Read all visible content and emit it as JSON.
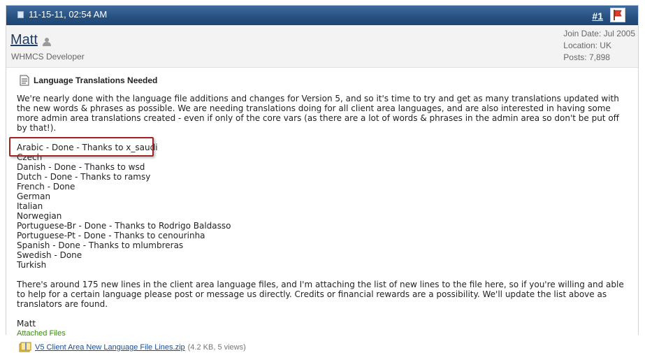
{
  "post": {
    "date": "11-15-11, 02:54 AM",
    "number": "#1",
    "icons": {
      "post": "post-icon",
      "report": "report-flag-icon",
      "offline": "user-offline-icon",
      "title": "document-icon",
      "zip": "zip-file-icon"
    },
    "colors": {
      "header": "#27507f",
      "highlight": "#a32322",
      "attached": "#3c8a14"
    }
  },
  "user": {
    "name": "Matt",
    "title": "WHMCS Developer",
    "join_date": "Join Date: Jul 2005",
    "location": "Location: UK",
    "posts": "Posts: 7,898"
  },
  "content": {
    "title": "Language Translations Needed",
    "intro": "We're nearly done with the language file additions and changes for Version 5, and so it's time to try and get as many translations updated with the new words & phrases as possible. We are needing translations doing for all client area languages, and are also interested in having some more admin area translations created - even if only of the core vars (as there are a lot of words & phrases in the admin area so don't be put off by that!).",
    "languages": [
      "Arabic - Done - Thanks to x_saudi",
      "Czech",
      "Danish - Done - Thanks to wsd",
      "Dutch - Done - Thanks to ramsy",
      "French - Done",
      "German",
      "Italian",
      "Norwegian",
      "Portuguese-Br - Done - Thanks to Rodrigo Baldasso",
      "Portuguese-Pt - Done - Thanks to cenourinha",
      "Spanish - Done - Thanks to mlumbreras",
      "Swedish - Done",
      "Turkish"
    ],
    "outro": "There's around 175 new lines in the client area language files, and I'm attaching the list of new lines to the file here, so if you're willing and able to help for a certain language please post or message us directly. Credits or financial rewards are a possibility. We'll update the list above as translators are found.",
    "signature": "Matt",
    "attached_label": "Attached Files",
    "attachment": {
      "name": "V5 Client Area New Language File Lines.zip",
      "meta": "(4.2 KB, 5 views)"
    }
  }
}
